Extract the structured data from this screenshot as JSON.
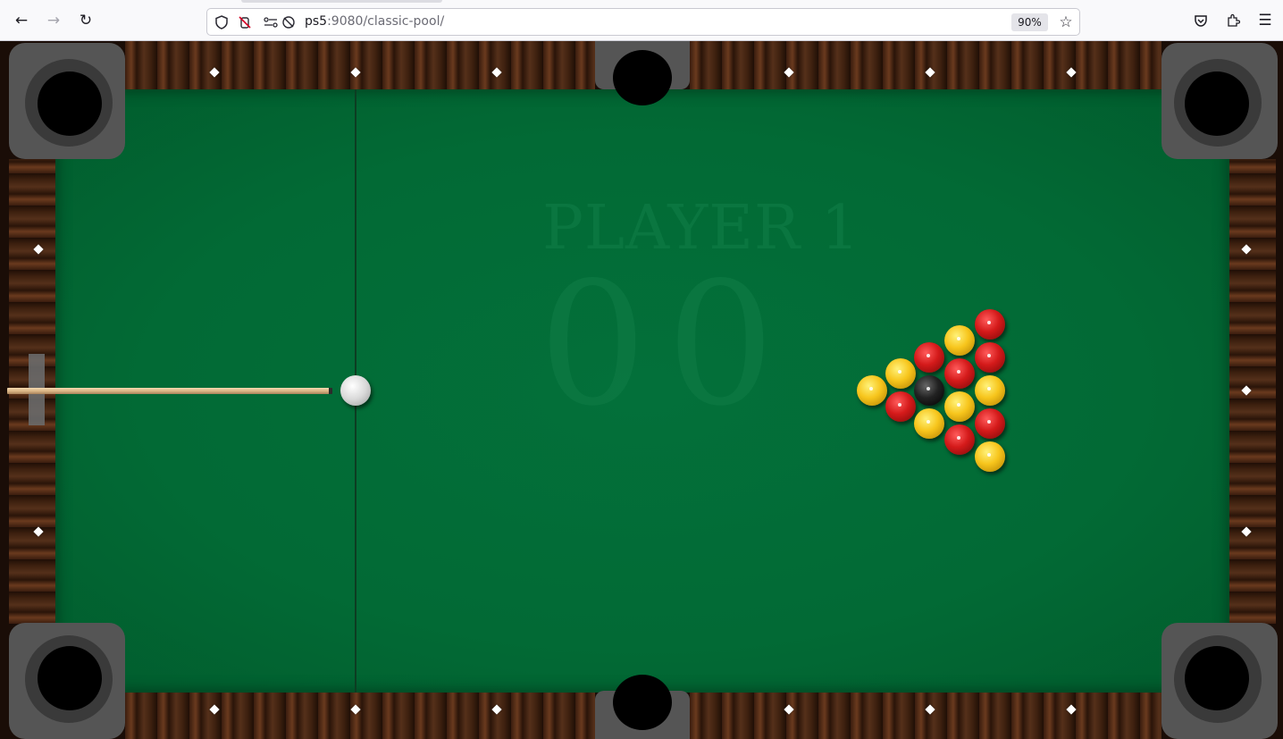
{
  "browser": {
    "url_host": "ps5",
    "url_rest": ":9080/classic-pool/",
    "zoom": "90%",
    "icons": [
      "back-arrow-icon",
      "forward-arrow-icon",
      "reload-icon",
      "shield-icon",
      "permissions-icon",
      "connection-icon",
      "tracking-protection-icon",
      "bookmark-star-icon",
      "pocket-icon",
      "extensions-icon",
      "menu-icon"
    ]
  },
  "game": {
    "player_label": "PLAYER 1",
    "score_left": "0",
    "score_right": "0",
    "colors": {
      "felt": "#026a35",
      "red_ball": "#d41a1a",
      "yellow_ball": "#f7c51c",
      "black_ball": "#222222",
      "cue_ball": "#d9d9d9"
    },
    "balls": [
      {
        "color": "yellow"
      },
      {
        "color": "yellow"
      },
      {
        "color": "red"
      },
      {
        "color": "red"
      },
      {
        "color": "black"
      },
      {
        "color": "yellow"
      },
      {
        "color": "yellow"
      },
      {
        "color": "red"
      },
      {
        "color": "yellow"
      },
      {
        "color": "red"
      },
      {
        "color": "red"
      },
      {
        "color": "red"
      },
      {
        "color": "yellow"
      },
      {
        "color": "red"
      },
      {
        "color": "yellow"
      }
    ]
  }
}
